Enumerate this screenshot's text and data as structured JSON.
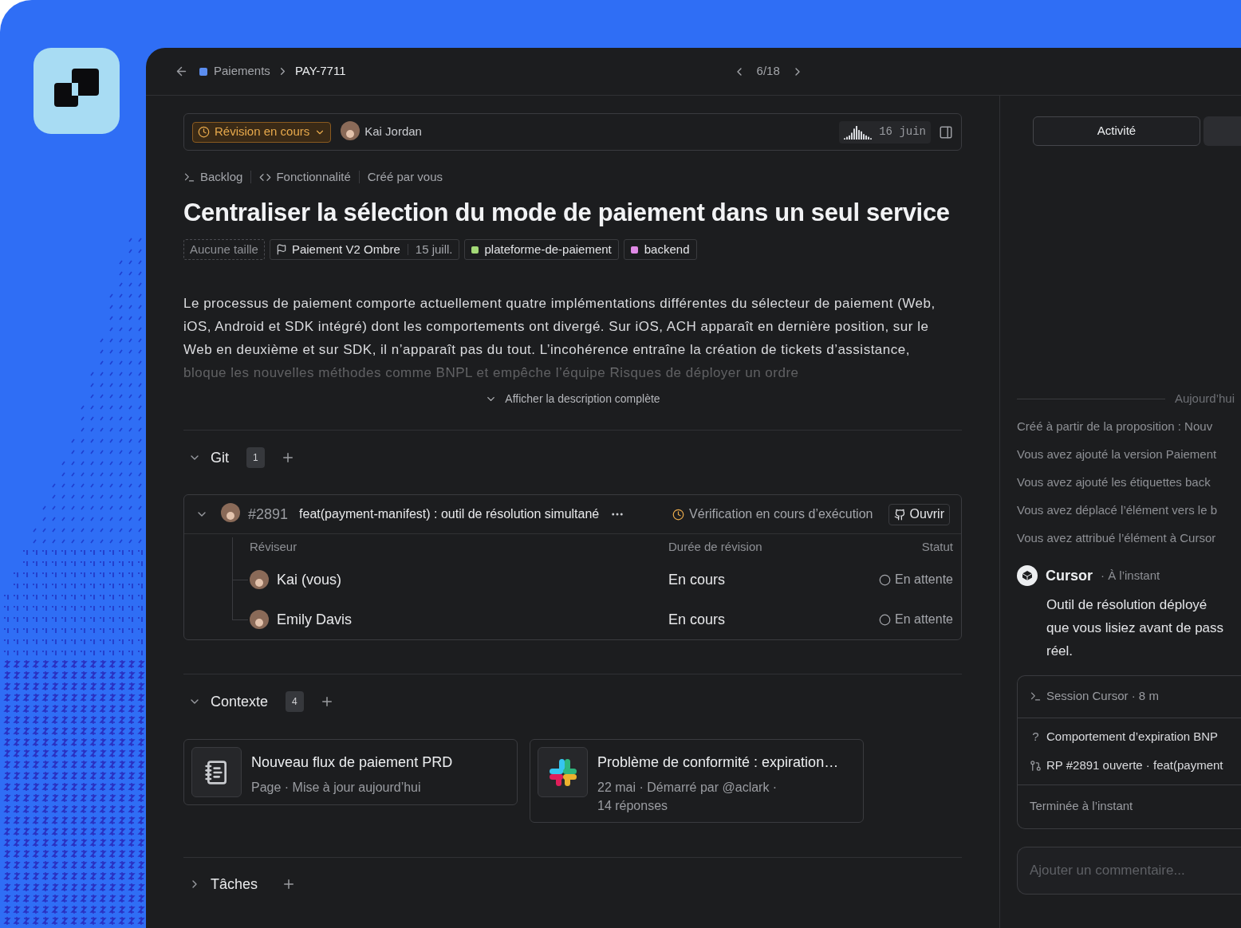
{
  "header": {
    "breadcrumb": [
      {
        "label": "Paiements",
        "color": "#5b8def"
      },
      {
        "label": "PAY-7711"
      }
    ],
    "pager": "6/18"
  },
  "issue": {
    "status": "Révision en cours",
    "assignee": "Kai Jordan",
    "date": "16 juin",
    "meta": [
      {
        "kind": "terminal",
        "label": "Backlog"
      },
      {
        "kind": "code",
        "label": "Fonctionnalité"
      },
      {
        "kind": "plain",
        "label": "Créé par vous"
      }
    ],
    "title": "Centraliser la sélection du mode de paiement dans un seul service",
    "tags": [
      {
        "kind": "empty",
        "label": "Aucune taille"
      },
      {
        "kind": "release",
        "label": "Paiement V2 Ombre",
        "date": "15 juill."
      },
      {
        "kind": "label",
        "label": "plateforme-de-paiement",
        "color": "#a3d977"
      },
      {
        "kind": "label",
        "label": "backend",
        "color": "#e08ae6"
      }
    ],
    "description": "Le processus de paiement comporte actuellement quatre implémentations différentes du sélecteur de paiement (Web, iOS, Android et SDK intégré) dont les comportements ont divergé. Sur iOS, ACH apparaît en dernière position, sur le Web en deuxième et sur SDK, il n’apparaît pas du tout. L’incohérence entraîne la création de tickets d’assistance, bloque les nouvelles méthodes comme BNPL et empêche l’équipe Risques de déployer un ordre",
    "show_more": "Afficher la description complète"
  },
  "git": {
    "title": "Git",
    "count": "1",
    "expanded": true,
    "pr": {
      "expanded": true,
      "number": "#2891",
      "title": "feat(payment-manifest) : outil de résolution simultané",
      "check": "Vérification en cours d’exécution",
      "open": "Ouvrir",
      "columns": [
        "Réviseur",
        "Durée de révision",
        "Statut"
      ],
      "reviewers": [
        {
          "name": "Kai (vous)",
          "duration": "En cours",
          "status": "En attente"
        },
        {
          "name": "Emily Davis",
          "duration": "En cours",
          "status": "En attente"
        }
      ]
    }
  },
  "context": {
    "title": "Contexte",
    "count": "4",
    "expanded": true,
    "cards": [
      {
        "kind": "page",
        "title": "Nouveau flux de paiement PRD",
        "lines": [
          "Page · Mise à jour aujourd’hui"
        ]
      },
      {
        "kind": "slack",
        "title": "Problème de conformité : expiration…",
        "lines": [
          "22 mai · Démarré par @aclark ·",
          "14 réponses"
        ]
      }
    ]
  },
  "tasks": {
    "title": "Tâches",
    "expanded": false
  },
  "activity": {
    "tabs": [
      {
        "label": "Activité",
        "selected": true
      }
    ],
    "day": "Aujourd’hui",
    "events": [
      "Créé à partir de la proposition : Nouv",
      "Vous avez ajouté la version Paiement",
      "Vous avez ajouté les étiquettes back",
      "Vous avez déplacé l’élément vers le b",
      "Vous avez attribué l’élément à Cursor"
    ],
    "comment": {
      "author": "Cursor",
      "time": "· À l’instant",
      "text": [
        "Outil de résolution déployé",
        "que vous lisiez avant de pass",
        "réel."
      ]
    },
    "session": {
      "title": "Session Cursor · 8 m",
      "items": [
        {
          "kind": "question",
          "mark": "?",
          "text": "Comportement d’expiration BNP"
        },
        {
          "kind": "pr",
          "text": "RP #2891 ouverte · feat(payment"
        }
      ],
      "footer": "Terminée à l’instant"
    },
    "input": {
      "placeholder": "Ajouter un commentaire..."
    }
  }
}
